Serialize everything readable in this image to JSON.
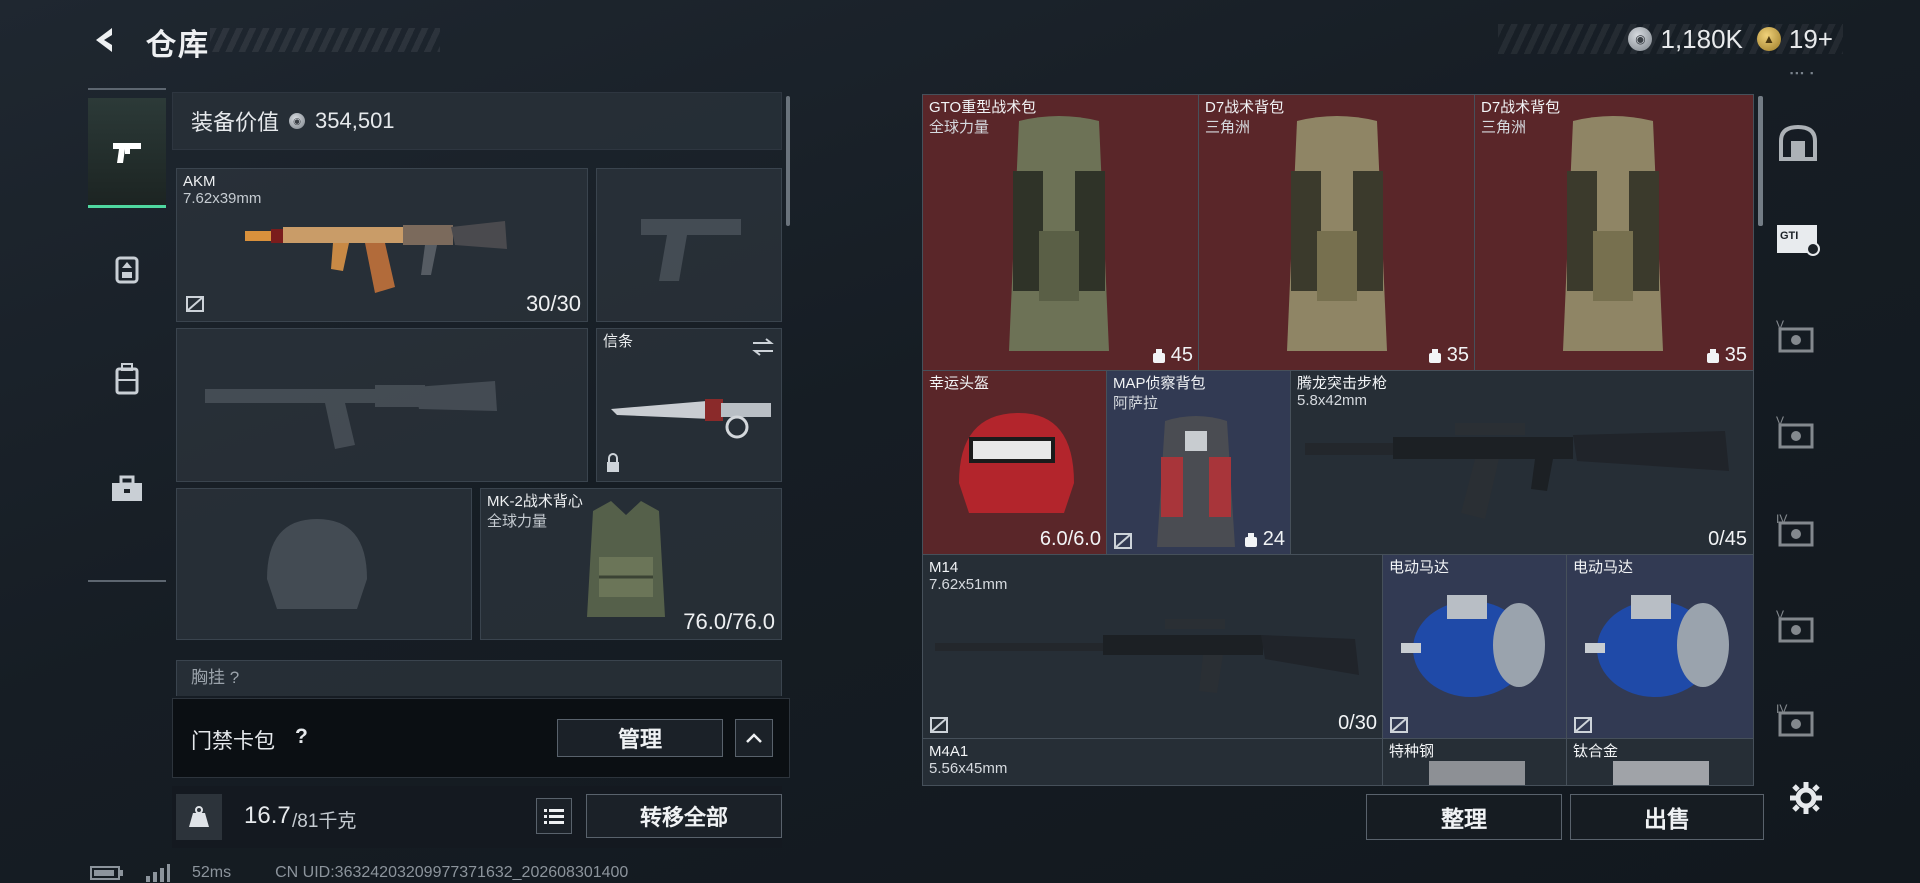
{
  "header": {
    "title": "仓库",
    "back_icon": "back-arrow-icon"
  },
  "currency": [
    {
      "icon": "silver-coin-icon",
      "value": "1,180K"
    },
    {
      "icon": "gold-coin-icon",
      "value": "19+"
    }
  ],
  "equipment_value": {
    "label": "装备价值",
    "value": "354,501"
  },
  "left_tabs": [
    {
      "icon": "pistol-icon",
      "active": true
    },
    {
      "icon": "helmet-icon",
      "active": false
    },
    {
      "icon": "backpack-icon",
      "active": false
    },
    {
      "icon": "toolbox-icon",
      "active": false
    }
  ],
  "loadout": {
    "primary": {
      "name": "AKM",
      "caliber": "7.62x39mm",
      "ammo": "30/30"
    },
    "knife": {
      "name": "信条"
    },
    "armor": {
      "name": "MK-2战术背心",
      "faction": "全球力量",
      "durability": "76.0/76.0"
    },
    "next_section": "胸挂 ?"
  },
  "card_pack": {
    "label": "门禁卡包",
    "help": "?",
    "manage": "管理"
  },
  "weight": {
    "icon": "kg-weight-icon",
    "current": "16.7",
    "max": "/81千克",
    "transfer_all": "转移全部"
  },
  "status_bar": {
    "ping": "52ms",
    "uid": "CN UID:363242032099773716​32_202608301400"
  },
  "storage": [
    {
      "name": "GTO重型战术包",
      "sub": "全球力量",
      "count": "45",
      "color": "red"
    },
    {
      "name": "D7战术背包",
      "sub": "三角洲",
      "count": "35",
      "color": "red"
    },
    {
      "name": "D7战术背包",
      "sub": "三角洲",
      "count": "35",
      "color": "red"
    },
    {
      "name": "幸运头盔",
      "sub": "",
      "count": "6.0/6.0",
      "color": "red"
    },
    {
      "name": "MAP侦察背包",
      "sub": "阿萨拉",
      "count": "24",
      "color": "blue"
    },
    {
      "name": "腾龙突击步枪",
      "sub": "5.8x42mm",
      "count": "0/45",
      "color": "dark"
    },
    {
      "name": "M14",
      "sub": "7.62x51mm",
      "count": "0/30",
      "color": "dark"
    },
    {
      "name": "电动马达",
      "sub": "",
      "count": "",
      "color": "blue"
    },
    {
      "name": "电动马达",
      "sub": "",
      "count": "",
      "color": "blue"
    },
    {
      "name": "M4A1",
      "sub": "5.56x45mm",
      "count": "",
      "color": "dark"
    },
    {
      "name": "特种钢",
      "sub": "",
      "count": "",
      "color": "dark"
    },
    {
      "name": "钛合金",
      "sub": "",
      "count": "",
      "color": "dark"
    }
  ],
  "side_tabs": [
    "vault-icon",
    "gti-case-icon",
    "tier-v-case-icon",
    "tier-v-case-icon",
    "tier-iv-case-icon",
    "tier-v-case-icon",
    "tier-iv-case-icon"
  ],
  "actions": {
    "organize": "整理",
    "sell": "出售",
    "settings_icon": "gear-icon"
  },
  "marks": {
    "tiny": "▪▪▪ ▪"
  }
}
